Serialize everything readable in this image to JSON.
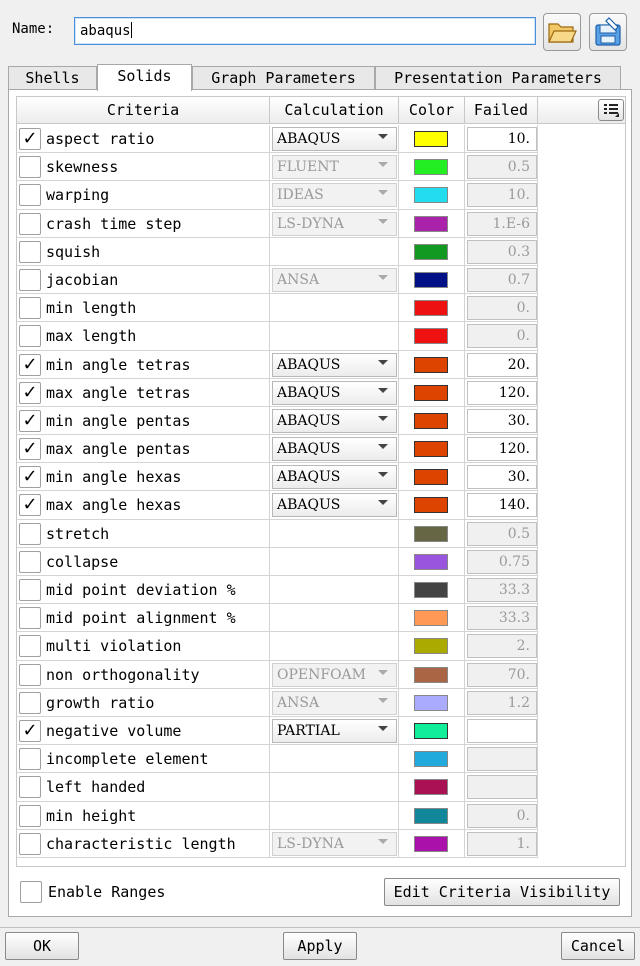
{
  "name_field": {
    "label": "Name:",
    "value": "abaqus"
  },
  "tabs": [
    "Shells",
    "Solids",
    "Graph Parameters",
    "Presentation Parameters"
  ],
  "active_tab": "Solids",
  "columns": {
    "criteria": "Criteria",
    "calculation": "Calculation",
    "color": "Color",
    "failed": "Failed"
  },
  "rows": [
    {
      "checked": true,
      "criteria": "aspect ratio",
      "calc": "ABAQUS",
      "calc_enabled": true,
      "color": "#ffff00",
      "failed": "10."
    },
    {
      "checked": false,
      "criteria": "skewness",
      "calc": "FLUENT",
      "calc_enabled": false,
      "color": "#22ee22",
      "failed": "0.5"
    },
    {
      "checked": false,
      "criteria": "warping",
      "calc": "IDEAS",
      "calc_enabled": false,
      "color": "#22ddee",
      "failed": "10."
    },
    {
      "checked": false,
      "criteria": "crash time step",
      "calc": "LS-DYNA",
      "calc_enabled": false,
      "color": "#aa22aa",
      "failed": "1.E-6"
    },
    {
      "checked": false,
      "criteria": "squish",
      "calc": "",
      "calc_enabled": false,
      "color": "#119922",
      "failed": "0.3"
    },
    {
      "checked": false,
      "criteria": "jacobian",
      "calc": "ANSA",
      "calc_enabled": false,
      "color": "#001188",
      "failed": "0.7"
    },
    {
      "checked": false,
      "criteria": "min length",
      "calc": "",
      "calc_enabled": false,
      "color": "#ee1111",
      "failed": "0."
    },
    {
      "checked": false,
      "criteria": "max length",
      "calc": "",
      "calc_enabled": false,
      "color": "#ee1111",
      "failed": "0."
    },
    {
      "checked": true,
      "criteria": "min angle tetras",
      "calc": "ABAQUS",
      "calc_enabled": true,
      "color": "#dd4400",
      "failed": "20."
    },
    {
      "checked": true,
      "criteria": "max angle tetras",
      "calc": "ABAQUS",
      "calc_enabled": true,
      "color": "#dd4400",
      "failed": "120."
    },
    {
      "checked": true,
      "criteria": "min angle pentas",
      "calc": "ABAQUS",
      "calc_enabled": true,
      "color": "#dd4400",
      "failed": "30."
    },
    {
      "checked": true,
      "criteria": "max angle pentas",
      "calc": "ABAQUS",
      "calc_enabled": true,
      "color": "#dd4400",
      "failed": "120."
    },
    {
      "checked": true,
      "criteria": "min angle hexas",
      "calc": "ABAQUS",
      "calc_enabled": true,
      "color": "#dd4400",
      "failed": "30."
    },
    {
      "checked": true,
      "criteria": "max angle hexas",
      "calc": "ABAQUS",
      "calc_enabled": true,
      "color": "#dd4400",
      "failed": "140."
    },
    {
      "checked": false,
      "criteria": "stretch",
      "calc": "",
      "calc_enabled": false,
      "color": "#666644",
      "failed": "0.5"
    },
    {
      "checked": false,
      "criteria": "collapse",
      "calc": "",
      "calc_enabled": false,
      "color": "#9955dd",
      "failed": "0.75"
    },
    {
      "checked": false,
      "criteria": "mid point deviation %",
      "calc": "",
      "calc_enabled": false,
      "color": "#444444",
      "failed": "33.3"
    },
    {
      "checked": false,
      "criteria": "mid point alignment %",
      "calc": "",
      "calc_enabled": false,
      "color": "#ff9955",
      "failed": "33.3"
    },
    {
      "checked": false,
      "criteria": "multi violation",
      "calc": "",
      "calc_enabled": false,
      "color": "#aaaa00",
      "failed": "2."
    },
    {
      "checked": false,
      "criteria": "non orthogonality",
      "calc": "OPENFOAM",
      "calc_enabled": false,
      "color": "#aa6644",
      "failed": "70."
    },
    {
      "checked": false,
      "criteria": "growth ratio",
      "calc": "ANSA",
      "calc_enabled": false,
      "color": "#aaaaff",
      "failed": "1.2"
    },
    {
      "checked": true,
      "criteria": "negative volume",
      "calc": "PARTIAL",
      "calc_enabled": true,
      "color": "#11ee99",
      "failed": ""
    },
    {
      "checked": false,
      "criteria": "incomplete element",
      "calc": "",
      "calc_enabled": false,
      "color": "#22aadd",
      "failed": ""
    },
    {
      "checked": false,
      "criteria": "left handed",
      "calc": "",
      "calc_enabled": false,
      "color": "#aa1155",
      "failed": ""
    },
    {
      "checked": false,
      "criteria": "min height",
      "calc": "",
      "calc_enabled": false,
      "color": "#118899",
      "failed": "0."
    },
    {
      "checked": false,
      "criteria": "characteristic length",
      "calc": "LS-DYNA",
      "calc_enabled": false,
      "color": "#aa11aa",
      "failed": "1."
    }
  ],
  "enable_ranges_label": "Enable Ranges",
  "edit_visibility_label": "Edit Criteria Visibility",
  "buttons": {
    "ok": "OK",
    "apply": "Apply",
    "cancel": "Cancel"
  }
}
